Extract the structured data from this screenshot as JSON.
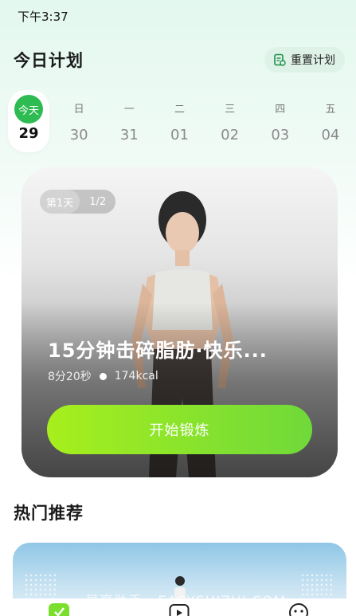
{
  "status_bar": {
    "time": "下午3:37"
  },
  "header": {
    "title": "今日计划",
    "reset_label": "重置计划"
  },
  "week": [
    {
      "label": "今天",
      "num": "29",
      "selected": true
    },
    {
      "label": "日",
      "num": "30"
    },
    {
      "label": "一",
      "num": "31"
    },
    {
      "label": "二",
      "num": "01"
    },
    {
      "label": "三",
      "num": "02"
    },
    {
      "label": "四",
      "num": "03"
    },
    {
      "label": "五",
      "num": "04"
    }
  ],
  "hero": {
    "day_tag": "第1天",
    "count_tag": "1/2",
    "title": "15分钟击碎脂肪·快乐...",
    "duration": "8分20秒",
    "calories": "174kcal",
    "start_label": "开始锻炼"
  },
  "recommend": {
    "title": "热门推荐"
  },
  "watermark": "易享助手 · EASYSHIZHI.COM",
  "colors": {
    "accent_green": "#2dbb52",
    "button_start": "#a7ef1d",
    "button_end": "#6fd93a"
  },
  "icons": {
    "reset": "document-icon",
    "tab1": "home-icon",
    "tab2": "play-icon",
    "tab3": "profile-icon"
  }
}
